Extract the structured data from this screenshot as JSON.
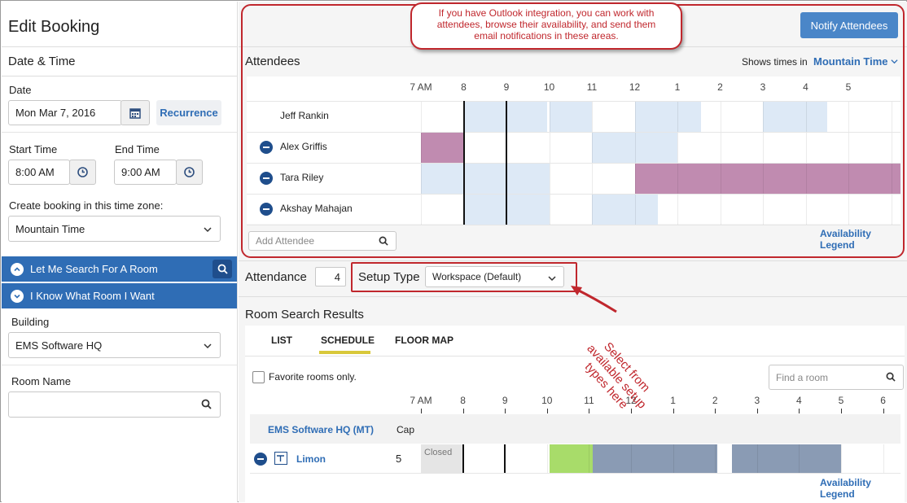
{
  "page_title": "Edit Booking",
  "callout_top": "If you have Outlook integration, you can work with attendees, browse their availability, and send them email notifications in these areas.",
  "callout_setup": "Select from available setup types here",
  "left": {
    "date_time_heading": "Date & Time",
    "date_label": "Date",
    "date_value": "Mon Mar 7, 2016",
    "recurrence_label": "Recurrence",
    "start_time_label": "Start Time",
    "start_time_value": "8:00 AM",
    "end_time_label": "End Time",
    "end_time_value": "9:00 AM",
    "timezone_label": "Create booking in this time zone:",
    "timezone_value": "Mountain Time",
    "search_room_label": "Let Me Search For A Room",
    "know_room_label": "I Know What Room I Want",
    "building_label": "Building",
    "building_value": "EMS Software HQ",
    "room_name_label": "Room Name",
    "room_name_value": ""
  },
  "notify_button": "Notify Attendees",
  "attendees": {
    "heading": "Attendees",
    "shows_times_label": "Shows times in",
    "timezone_link": "Mountain Time",
    "hours": [
      "7 AM",
      "8",
      "9",
      "10",
      "11",
      "12",
      "1",
      "2",
      "3",
      "4",
      "5"
    ],
    "people": [
      {
        "name": "Jeff Rankin",
        "removable": false
      },
      {
        "name": "Alex Griffis",
        "removable": true
      },
      {
        "name": "Tara Riley",
        "removable": true
      },
      {
        "name": "Akshay Mahajan",
        "removable": true
      }
    ],
    "add_placeholder": "Add Attendee",
    "legend_link": "Availability Legend"
  },
  "attendance_label": "Attendance",
  "attendance_value": "4",
  "setup_type_label": "Setup Type",
  "setup_type_value": "Workspace (Default)",
  "room_results": {
    "heading": "Room Search Results",
    "tabs": [
      "LIST",
      "SCHEDULE",
      "FLOOR MAP"
    ],
    "active_tab": "SCHEDULE",
    "favorites_label": "Favorite rooms only.",
    "find_placeholder": "Find a room",
    "hours": [
      "7 AM",
      "8",
      "9",
      "10",
      "11",
      "12",
      "1",
      "2",
      "3",
      "4",
      "5",
      "6"
    ],
    "building_row": "EMS Software HQ (MT)",
    "cap_label": "Cap",
    "room_name": "Limon",
    "room_cap": "5",
    "closed_label": "Closed",
    "legend_link": "Availability Legend"
  },
  "colors": {
    "accent": "#2f6db5",
    "busy": "#c08bb0",
    "tentative": "#dde9f6",
    "available_green": "#a8dc6a",
    "booked_slate": "#8a9bb4",
    "callout_border": "#c0272d"
  }
}
